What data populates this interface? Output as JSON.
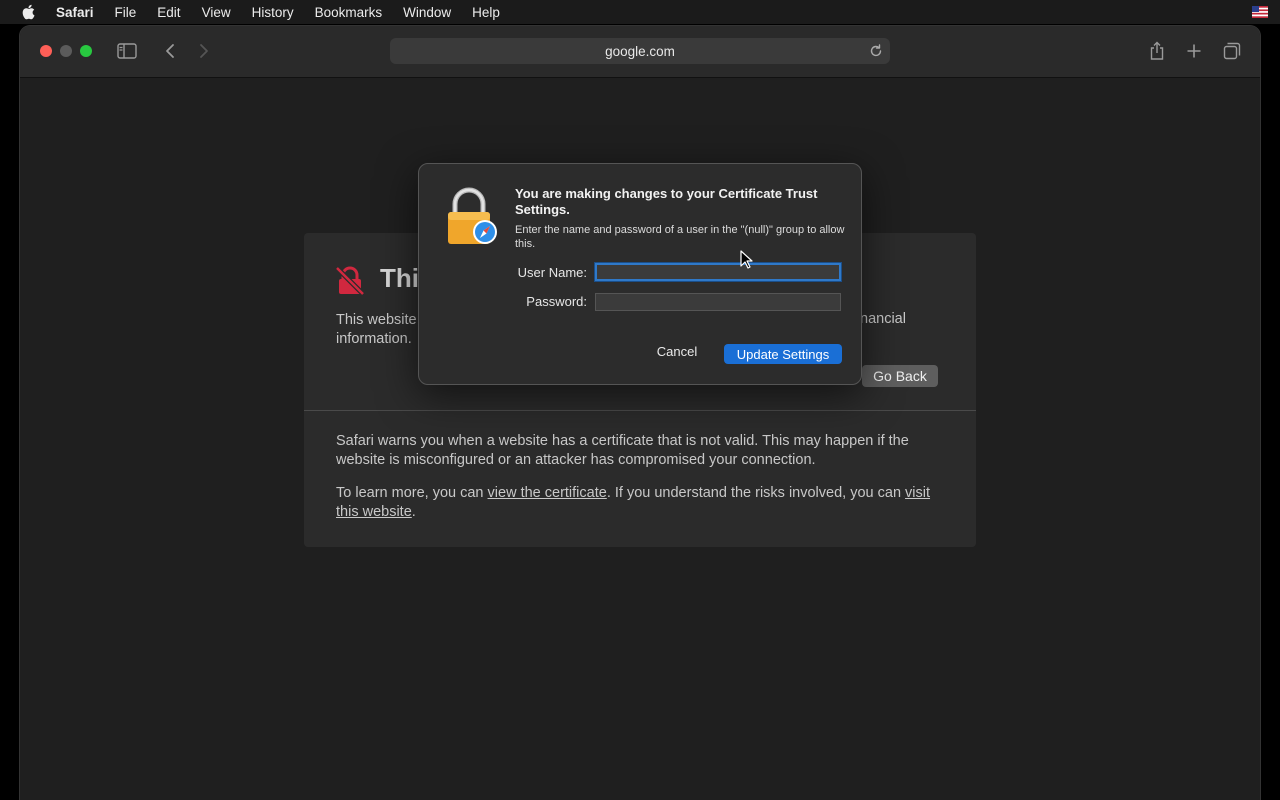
{
  "menubar": {
    "app": "Safari",
    "items": [
      "File",
      "Edit",
      "View",
      "History",
      "Bookmarks",
      "Window",
      "Help"
    ]
  },
  "toolbar": {
    "address": "google.com"
  },
  "warning": {
    "title_visible": "Thi",
    "text_left": "This website",
    "text_left_2": "information.",
    "text_right": "nancial",
    "go_back": "Go Back",
    "explain_1": "Safari warns you when a website has a certificate that is not valid. This may happen if the website is misconfigured or an attacker has compromised your connection.",
    "learn_prefix": "To learn more, you can ",
    "learn_link1": "view the certificate",
    "learn_middle": ". If you understand the risks involved, you can ",
    "learn_link2": "visit this website",
    "learn_suffix": "."
  },
  "dialog": {
    "title": "You are making changes to your Certificate Trust Settings.",
    "message": "Enter the name and password of a user in the \"(null)\" group to allow this.",
    "username_label": "User Name:",
    "password_label": "Password:",
    "username_value": "",
    "password_value": "",
    "cancel": "Cancel",
    "confirm": "Update Settings"
  },
  "colors": {
    "accent": "#1a6fd6",
    "close": "#fe5f57",
    "maximize": "#28c840",
    "warning_red": "#d1283f"
  }
}
